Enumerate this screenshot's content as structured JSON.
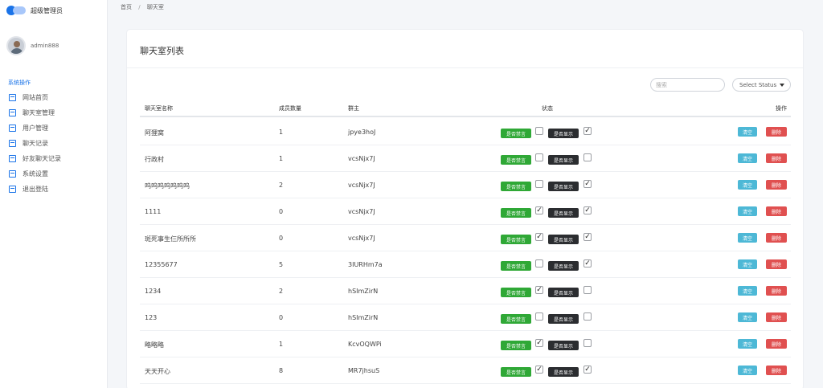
{
  "sidebar": {
    "brand": "超级管理员",
    "username": "admin888",
    "section_title": "系统操作",
    "items": [
      {
        "label": "网站首页",
        "icon": "grid-icon"
      },
      {
        "label": "聊天室管理",
        "icon": "grid-icon"
      },
      {
        "label": "用户管理",
        "icon": "grid-icon"
      },
      {
        "label": "聊天记录",
        "icon": "grid-icon"
      },
      {
        "label": "好友聊天记录",
        "icon": "grid-icon"
      },
      {
        "label": "系统设置",
        "icon": "grid-icon"
      },
      {
        "label": "退出登陆",
        "icon": "grid-icon"
      }
    ]
  },
  "breadcrumb": {
    "home": "首页",
    "sep": "/",
    "current": "聊天室"
  },
  "card": {
    "title": "聊天室列表"
  },
  "filters": {
    "search_placeholder": "搜索",
    "status_label": "Select Status"
  },
  "table": {
    "headers": {
      "name": "聊天室名称",
      "members": "成员数量",
      "owner": "群主",
      "status": "状态",
      "actions": "操作"
    },
    "mute_label": "是否禁言",
    "show_label": "是否显示",
    "clear_label": "清空",
    "delete_label": "删除",
    "rows": [
      {
        "name": "阿狸窝",
        "members": "1",
        "owner": "jpye3hoJ",
        "muted": false,
        "shown": true
      },
      {
        "name": "行政村",
        "members": "1",
        "owner": "vcsNjx7J",
        "muted": false,
        "shown": false
      },
      {
        "name": "呜呜呜呜呜呜呜",
        "members": "2",
        "owner": "vcsNjx7J",
        "muted": false,
        "shown": true
      },
      {
        "name": "1111",
        "members": "0",
        "owner": "vcsNjx7J",
        "muted": true,
        "shown": true
      },
      {
        "name": "斑死事生仨所所所",
        "members": "0",
        "owner": "vcsNjx7J",
        "muted": true,
        "shown": true
      },
      {
        "name": "12355677",
        "members": "5",
        "owner": "3IURHm7a",
        "muted": false,
        "shown": true
      },
      {
        "name": "1234",
        "members": "2",
        "owner": "hSImZirN",
        "muted": true,
        "shown": false
      },
      {
        "name": "123",
        "members": "0",
        "owner": "hSImZirN",
        "muted": false,
        "shown": false
      },
      {
        "name": "略略略",
        "members": "1",
        "owner": "KcvOQWPi",
        "muted": true,
        "shown": false
      },
      {
        "name": "天天开心",
        "members": "8",
        "owner": "MR7jhsuS",
        "muted": true,
        "shown": true
      }
    ]
  },
  "colors": {
    "accent": "#1a73e8",
    "mute_btn": "#2fa836",
    "show_btn": "#2b2d30",
    "clear_btn": "#4db8d6",
    "delete_btn": "#e05050"
  }
}
